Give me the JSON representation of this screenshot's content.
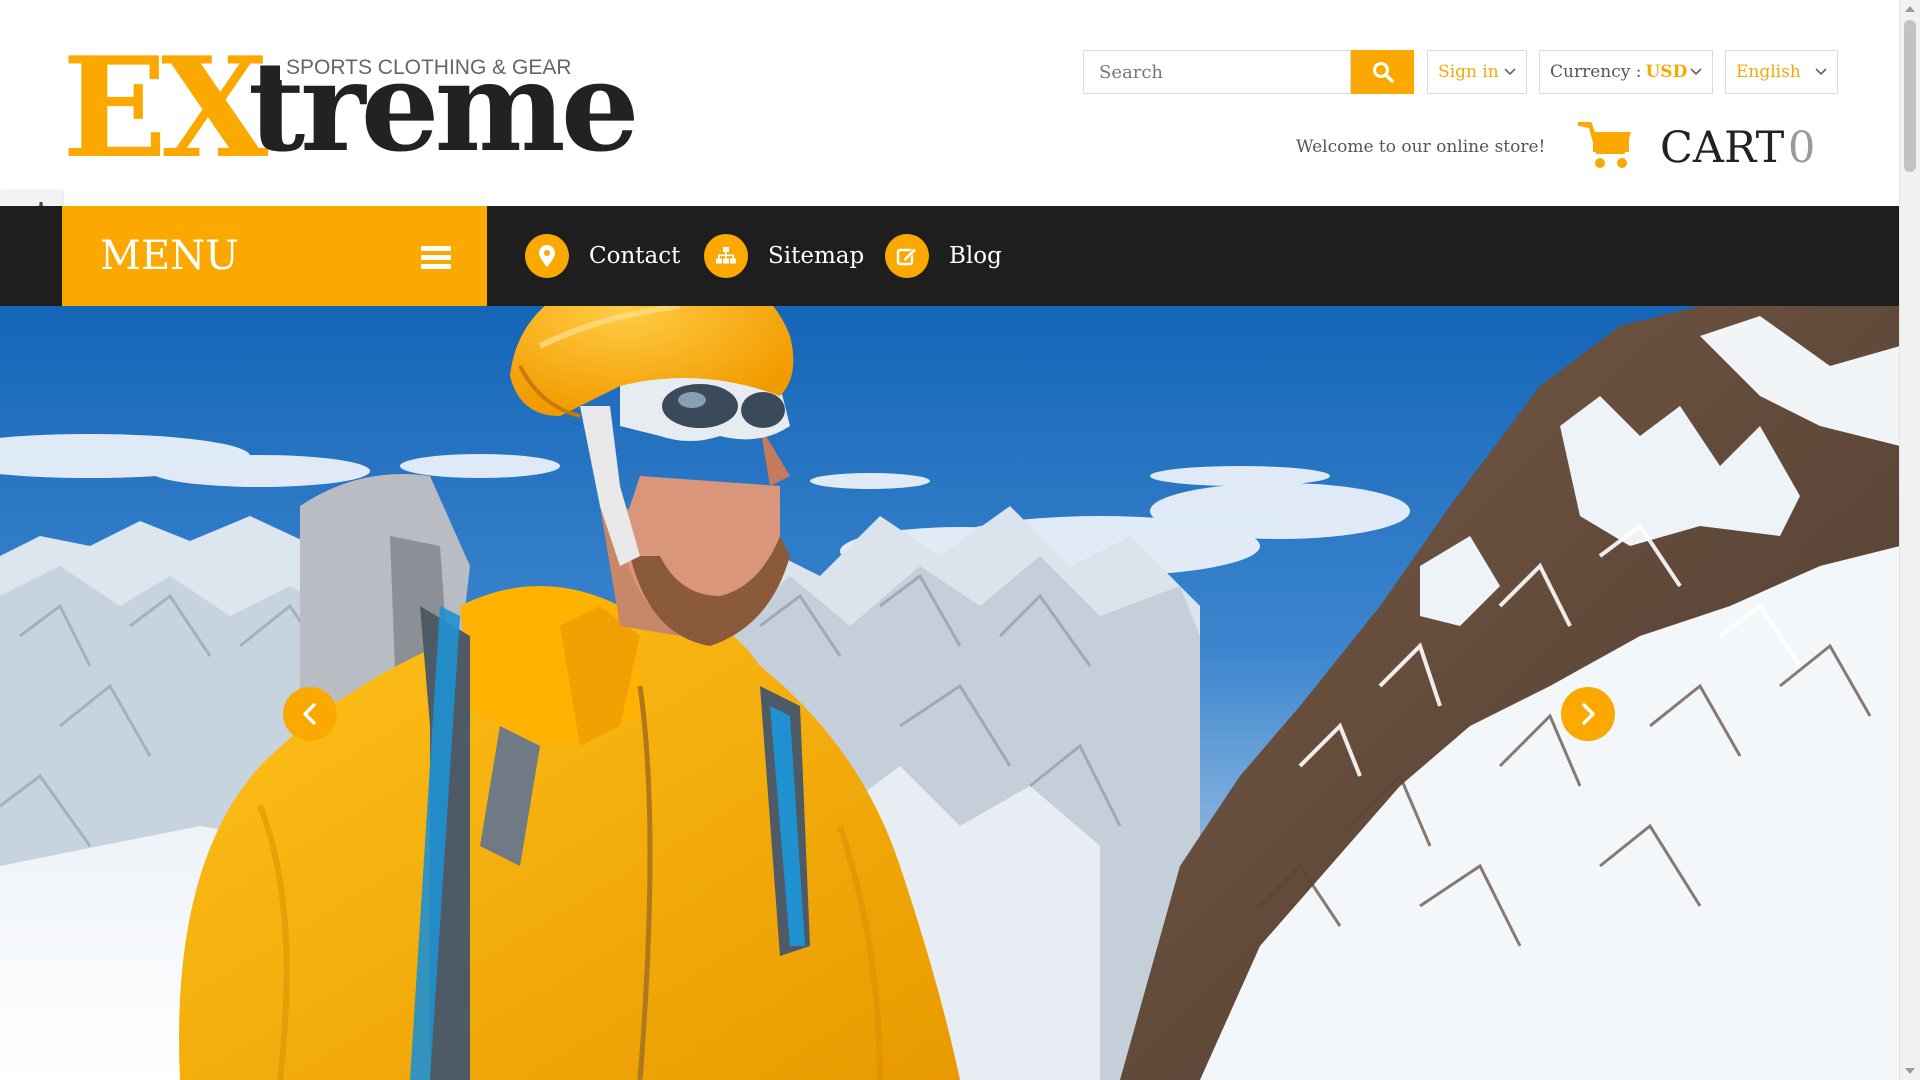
{
  "logo": {
    "part1": "EX",
    "part2": "treme",
    "tagline": "SPORTS CLOTHING & GEAR"
  },
  "header": {
    "search_placeholder": "Search",
    "sign_in": "Sign in",
    "currency_label": "Currency :",
    "currency_value": "USD",
    "language": "English",
    "welcome": "Welcome to our online store!",
    "cart_label": "CART",
    "cart_count": "0"
  },
  "nav": {
    "menu_label": "MENU",
    "items": [
      {
        "label": "Contact",
        "icon": "map-marker-icon"
      },
      {
        "label": "Sitemap",
        "icon": "sitemap-icon"
      },
      {
        "label": "Blog",
        "icon": "edit-icon"
      }
    ]
  },
  "hero": {
    "image": "climber-in-yellow-jacket-snowy-mountains",
    "controls": [
      "previous-slide",
      "next-slide"
    ]
  },
  "colors": {
    "accent": "#fba900",
    "nav_bg": "#1e1e1e",
    "text_dark": "#222222",
    "text_muted": "#555555"
  }
}
